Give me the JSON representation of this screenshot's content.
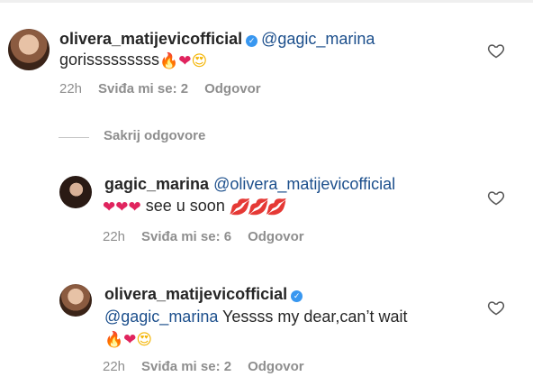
{
  "comments": [
    {
      "username": "olivera_matijevicofficial",
      "verified": true,
      "mention": "@gagic_marina",
      "text": "gorisssssssss",
      "emojis": [
        "fire",
        "red-heart",
        "heart-eyes"
      ],
      "time": "22h",
      "likes": "Sviđa mi se: 2",
      "reply": "Odgovor"
    },
    {
      "username": "gagic_marina",
      "verified": false,
      "mention": "@olivera_matijevicofficial",
      "text": "see u soon",
      "emojis_before": [
        "red-heart",
        "red-heart",
        "red-heart"
      ],
      "emojis_after": [
        "kiss-mark",
        "kiss-mark",
        "kiss-mark"
      ],
      "time": "22h",
      "likes": "Sviđa mi se: 6",
      "reply": "Odgovor"
    },
    {
      "username": "olivera_matijevicofficial",
      "verified": true,
      "mention": "@gagic_marina",
      "text": "Yessss my dear,can’t wait",
      "emojis": [
        "fire",
        "red-heart",
        "heart-eyes"
      ],
      "time": "22h",
      "likes": "Sviđa mi se: 2",
      "reply": "Odgovor"
    }
  ],
  "hide_replies": "Sakrij odgovore",
  "icons": {
    "like": "heart-outline-icon",
    "verified": "verified-badge-icon"
  },
  "colors": {
    "mention": "#1c4f8c",
    "meta": "#8e8e8e",
    "verified": "#3897f0"
  }
}
